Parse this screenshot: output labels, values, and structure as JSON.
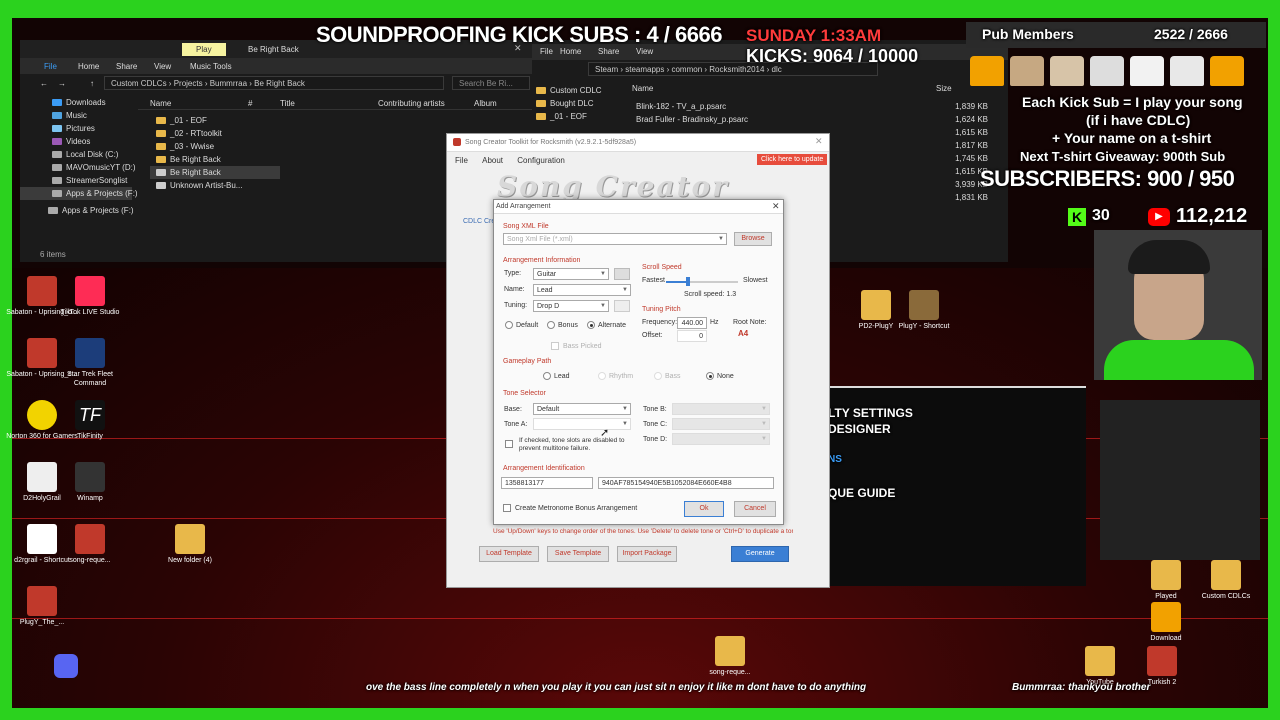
{
  "overlay": {
    "subs_title": "SOUNDPROOFING KICK SUBS : 4 / 6666",
    "day_time": "SUNDAY 1:33AM",
    "kicks": "KICKS: 9064 / 10000",
    "pub_label": "Pub Members",
    "pub_count": "2522 / 2666",
    "promo": [
      "Each Kick Sub = I play your song",
      "(if i have CDLC)",
      "+ Your name on a t-shirt",
      "Next T-shirt Giveaway: 900th Sub"
    ],
    "subscribers": "SUBSCRIBERS: 900 / 950",
    "kick_count": "30",
    "yt_count": "112,212",
    "ticker": "ove the bass line completely n when you play it you can just sit n enjoy it like m dont have to do anything",
    "ticker_user": "Bummrraa: thankyou brother",
    "side_panel": [
      "LTY SETTINGS",
      "DESIGNER",
      "NS",
      "QUE GUIDE"
    ]
  },
  "explorer_left": {
    "tabs": [
      "File",
      "Home",
      "Share",
      "View",
      "Music Tools"
    ],
    "play_label": "Play",
    "window_title": "Be Right Back",
    "breadcrumb": [
      "Custom CDLCs",
      "Projects",
      "Bummrraa",
      "Be Right Back"
    ],
    "search_placeholder": "Search Be Ri...",
    "nav": [
      "Downloads",
      "Music",
      "Pictures",
      "Videos",
      "Local Disk (C:)",
      "MAVOmusicYT (D:)",
      "StreamerSonglist",
      "Apps & Projects (F:)",
      "Apps & Projects (F:)"
    ],
    "columns": [
      "Name",
      "#",
      "Title",
      "Contributing artists",
      "Album"
    ],
    "files": [
      "_01 - EOF",
      "_02 - RTtoolkit",
      "_03 - Wwise",
      "Be Right Back",
      "Be Right Back",
      "Unknown Artist-Bu..."
    ],
    "status": "6 items"
  },
  "explorer_right": {
    "tabs": [
      "File",
      "Home",
      "Share",
      "View"
    ],
    "breadcrumb": [
      "Steam",
      "steamapps",
      "common",
      "Rocksmith2014",
      "dlc"
    ],
    "nav": [
      "Custom CDLC",
      "Bought DLC",
      "_01 - EOF"
    ],
    "col_name": "Name",
    "col_size": "Size",
    "files": [
      {
        "name": "Blink-182 - TV_a_p.psarc",
        "size": "1,839 KB"
      },
      {
        "name": "Brad Fuller - Bradinsky_p.psarc",
        "size": "1,624 KB"
      },
      {
        "name": "",
        "size": "1,615 KB"
      },
      {
        "name": "",
        "size": "1,817 KB"
      },
      {
        "name": "",
        "size": "1,745 KB"
      },
      {
        "name": "",
        "size": "1,615 KB"
      },
      {
        "name": "",
        "size": "3,939 KB"
      },
      {
        "name": "",
        "size": "1,831 KB"
      }
    ]
  },
  "desktop_icons": [
    {
      "label": "Sabaton - Uprising_b...",
      "color": "#d33"
    },
    {
      "label": "TikTok LIVE Studio",
      "color": "#fe2c55"
    },
    {
      "label": "Sabaton - Uprising_c...",
      "color": "#d33"
    },
    {
      "label": "Star Trek Fleet Command",
      "color": "#1c3d7a"
    },
    {
      "label": "Norton 360 for Gamers",
      "color": "#f2d300"
    },
    {
      "label": "TikFinity",
      "color": "#1b1b1b"
    },
    {
      "label": "D2HolyGrail",
      "color": "#eee"
    },
    {
      "label": "Winamp",
      "color": "#333"
    },
    {
      "label": "d2rgrail - Shortcut",
      "color": "#fff"
    },
    {
      "label": "song-reque...",
      "color": "#c0392b"
    },
    {
      "label": "New folder (4)",
      "color": "#e8b84a"
    },
    {
      "label": "PlugY_The_...",
      "color": "#c0392b"
    },
    {
      "label": "song-reque...",
      "color": "#e8b84a"
    }
  ],
  "desktop_icons_right": [
    {
      "label": "PD2-PlugY",
      "color": "#e8b84a"
    },
    {
      "label": "PlugY - Shortcut",
      "color": "#8a6a3a"
    },
    {
      "label": "Played",
      "color": "#e8b84a"
    },
    {
      "label": "Custom CDLCs",
      "color": "#e8b84a"
    },
    {
      "label": "Download",
      "color": "#f2a100"
    },
    {
      "label": "YouTube",
      "color": "#e8b84a"
    },
    {
      "label": "Turkish 2",
      "color": "#c0392b"
    }
  ],
  "toolkit": {
    "title": "Song Creator Toolkit for Rocksmith (v2.9.2.1-5df928a5)",
    "menu": [
      "File",
      "About",
      "Configuration"
    ],
    "update_label": "Click here to update",
    "logo": "Song Creator",
    "left_label": "CDLC Cre",
    "bottom_buttons": [
      "Load Template",
      "Save Template",
      "Import Package"
    ],
    "generate_label": "Generate"
  },
  "dialog": {
    "title": "Add Arrangement",
    "song_xml_group": "Song XML File",
    "xml_placeholder": "Song Xml File (*.xml)",
    "browse_label": "Browse",
    "arr_info_group": "Arrangement Information",
    "type_label": "Type:",
    "type_value": "Guitar",
    "name_label": "Name:",
    "name_value": "Lead",
    "tuning_label": "Tuning:",
    "tuning_value": "Drop D",
    "radio_default": "Default",
    "radio_bonus": "Bonus",
    "radio_alternate": "Alternate",
    "bass_picked": "Bass Picked",
    "scroll_speed_group": "Scroll Speed",
    "fastest": "Fastest",
    "slowest": "Slowest",
    "scroll_speed_value": "Scroll speed: 1.3",
    "scroll_speed_level": 0.3,
    "tuning_pitch_group": "Tuning Pitch",
    "frequency_label": "Frequency:",
    "frequency_value": "440.00",
    "hz": "Hz",
    "offset_label": "Offset:",
    "offset_value": "0",
    "root_note_label": "Root Note:",
    "root_note_value": "A4",
    "gameplay_group": "Gameplay Path",
    "path_lead": "Lead",
    "path_rhythm": "Rhythm",
    "path_bass": "Bass",
    "path_none": "None",
    "tone_group": "Tone Selector",
    "base_label": "Base:",
    "base_value": "Default",
    "tone_a_label": "Tone A:",
    "tone_b_label": "Tone B:",
    "tone_c_label": "Tone C:",
    "tone_d_label": "Tone D:",
    "multitone_text": "If checked, tone slots are disabled to prevent multitone failure.",
    "ident_group": "Arrangement Identification",
    "ident_id": "1358813177",
    "ident_guid": "940AF785154940E5B1052084E660E4B8",
    "metronome_label": "Create Metronome Bonus Arrangement",
    "ok_label": "Ok",
    "cancel_label": "Cancel",
    "hint": "Use 'Up/Down' keys to change order of the tones. Use 'Delete' to delete tone or 'Ctrl+D' to duplicate a tone"
  }
}
